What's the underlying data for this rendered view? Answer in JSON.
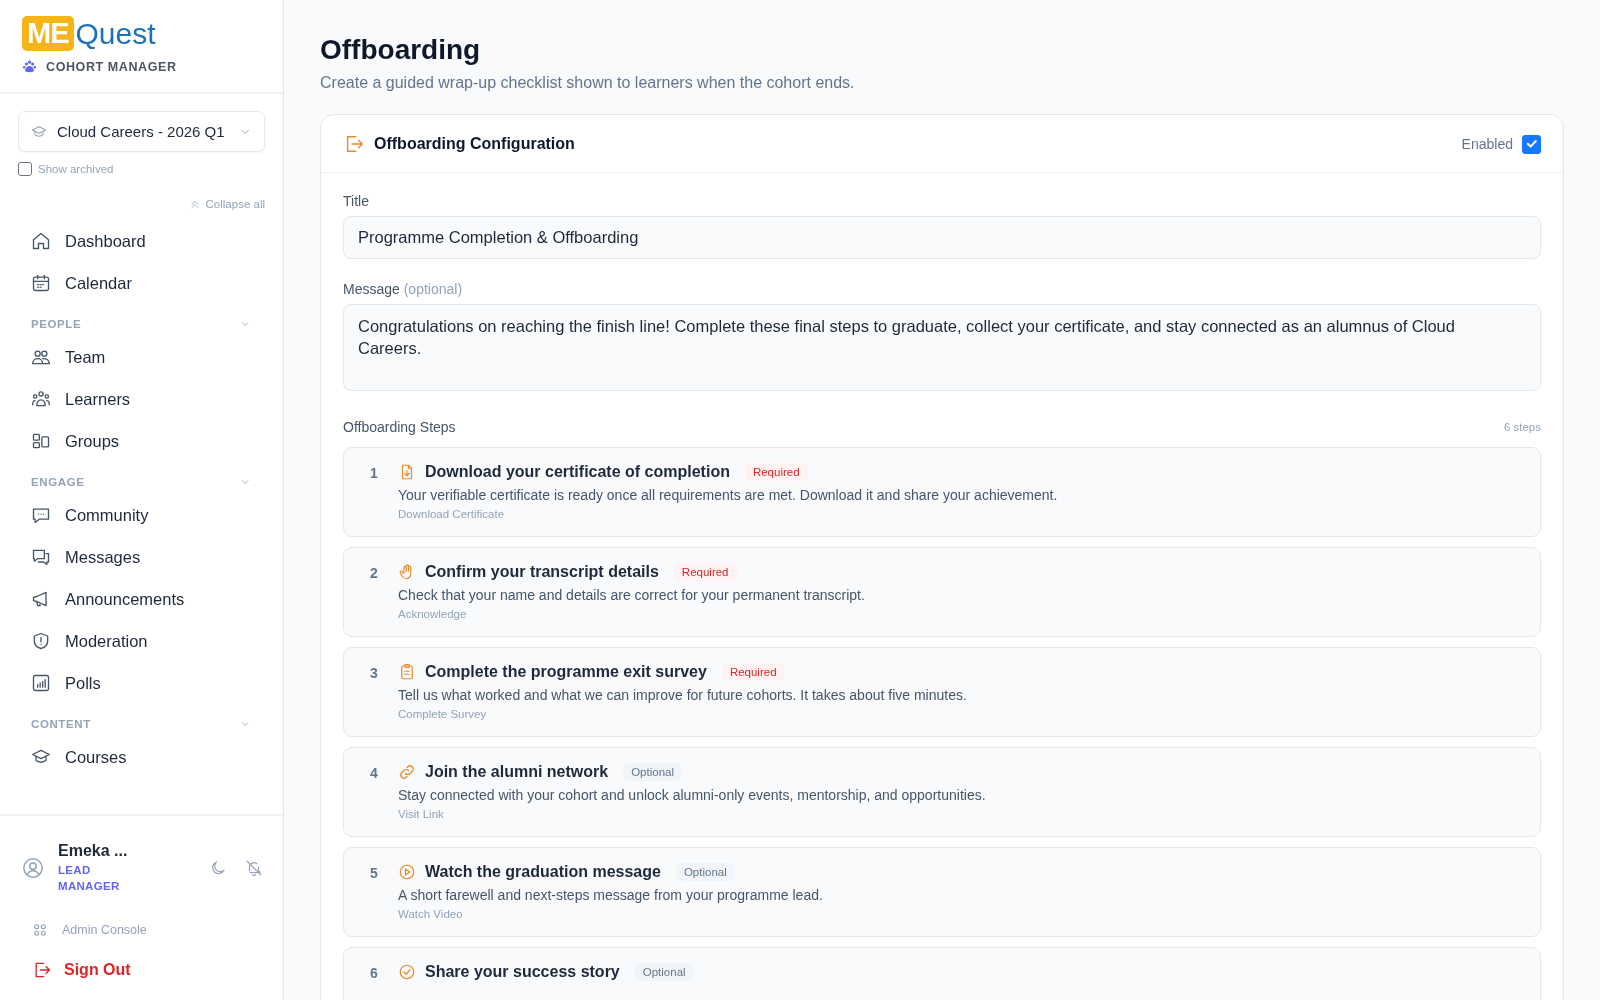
{
  "brand": {
    "logo_box": "ME",
    "logo_text": "Quest",
    "subtitle": "COHORT MANAGER"
  },
  "cohort_select": {
    "value": "Cloud Careers - 2026 Q1"
  },
  "show_archived": {
    "label": "Show archived",
    "checked": false
  },
  "collapse_all": "Collapse all",
  "nav": [
    {
      "items": [
        {
          "label": "Dashboard"
        },
        {
          "label": "Calendar"
        }
      ]
    },
    {
      "heading": "PEOPLE",
      "expanded": true,
      "items": [
        {
          "label": "Team"
        },
        {
          "label": "Learners"
        },
        {
          "label": "Groups"
        }
      ]
    },
    {
      "heading": "ENGAGE",
      "expanded": true,
      "items": [
        {
          "label": "Community"
        },
        {
          "label": "Messages"
        },
        {
          "label": "Announcements"
        },
        {
          "label": "Moderation"
        },
        {
          "label": "Polls"
        }
      ]
    },
    {
      "heading": "CONTENT",
      "expanded": true,
      "items": [
        {
          "label": "Courses"
        }
      ]
    }
  ],
  "user": {
    "name": "Emeka ...",
    "role": "LEAD MANAGER"
  },
  "admin_console": "Admin Console",
  "sign_out": "Sign Out",
  "page": {
    "title": "Offboarding",
    "subtitle": "Create a guided wrap-up checklist shown to learners when the cohort ends."
  },
  "config": {
    "title": "Offboarding Configuration",
    "enabled_label": "Enabled",
    "enabled": true,
    "title_label": "Title",
    "title_value": "Programme Completion & Offboarding",
    "message_label": "Message",
    "message_hint": "(optional)",
    "message_value": "Congratulations on reaching the finish line! Complete these final steps to graduate, collect your certificate, and stay connected as an alumnus of Cloud Careers.",
    "steps_label": "Offboarding Steps",
    "steps_count": "6 steps",
    "steps": [
      {
        "number": "1",
        "kind": "download",
        "title": "Download your certificate of completion",
        "badge": "Required",
        "required": true,
        "description": "Your verifiable certificate is ready once all requirements are met. Download it and share your achievement.",
        "action": "Download Certificate"
      },
      {
        "number": "2",
        "kind": "acknowledge",
        "title": "Confirm your transcript details",
        "badge": "Required",
        "required": true,
        "description": "Check that your name and details are correct for your permanent transcript.",
        "action": "Acknowledge"
      },
      {
        "number": "3",
        "kind": "survey",
        "title": "Complete the programme exit survey",
        "badge": "Required",
        "required": true,
        "description": "Tell us what worked and what we can improve for future cohorts. It takes about five minutes.",
        "action": "Complete Survey"
      },
      {
        "number": "4",
        "kind": "link",
        "title": "Join the alumni network",
        "badge": "Optional",
        "required": false,
        "description": "Stay connected with your cohort and unlock alumni-only events, mentorship, and opportunities.",
        "action": "Visit Link"
      },
      {
        "number": "5",
        "kind": "video",
        "title": "Watch the graduation message",
        "badge": "Optional",
        "required": false,
        "description": "A short farewell and next-steps message from your programme lead.",
        "action": "Watch Video"
      },
      {
        "number": "6",
        "kind": "check",
        "title": "Share your success story",
        "badge": "Optional",
        "required": false
      }
    ]
  }
}
